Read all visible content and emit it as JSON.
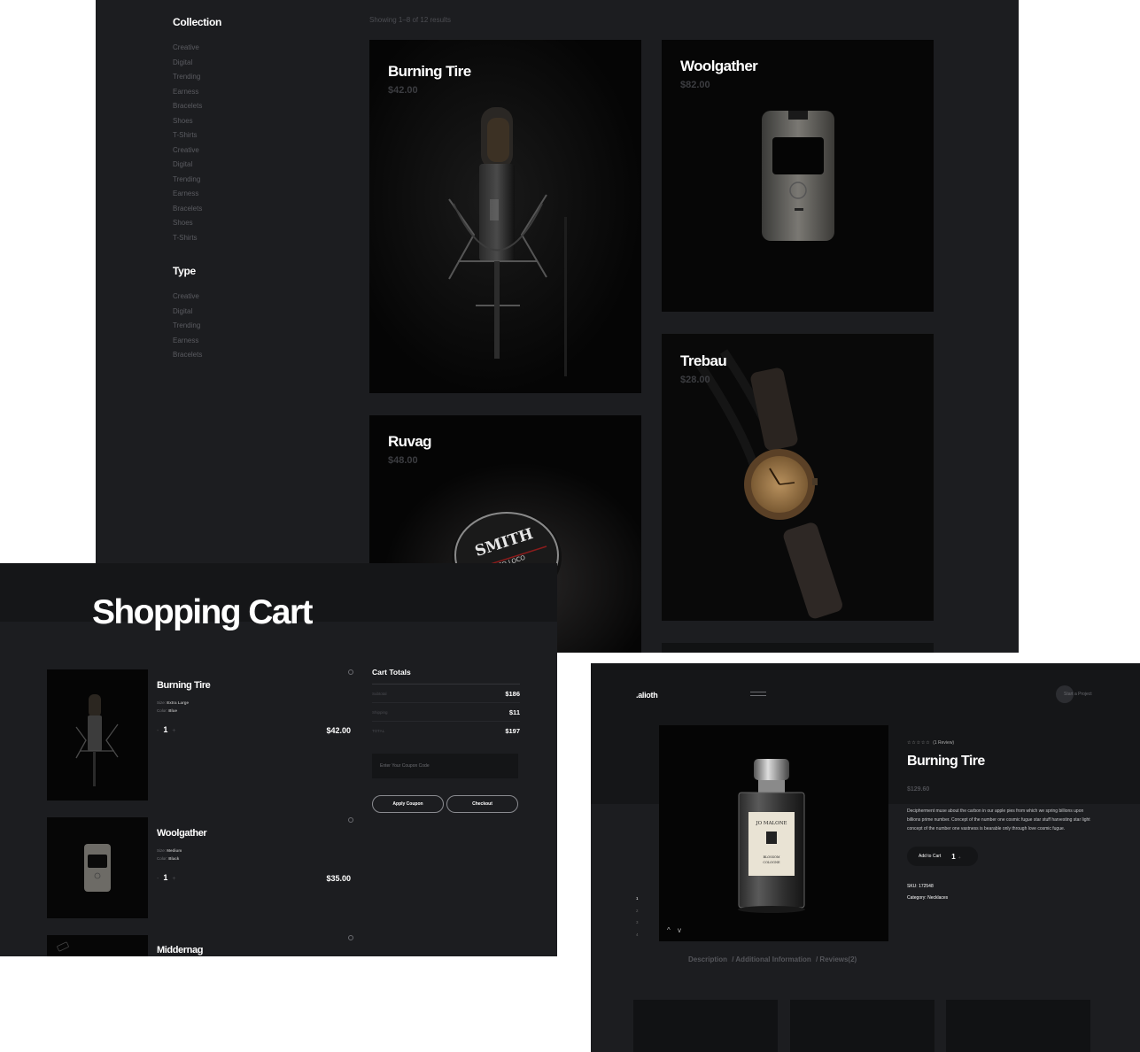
{
  "shop": {
    "sidebar": {
      "collection_heading": "Collection",
      "collection_items": [
        "Creative",
        "Digital",
        "Trending",
        "Earness",
        "Bracelets",
        "Shoes",
        "T-Shirts",
        "Creative",
        "Digital",
        "Trending",
        "Earness",
        "Bracelets",
        "Shoes",
        "T-Shirts"
      ],
      "type_heading": "Type",
      "type_items": [
        "Creative",
        "Digital",
        "Trending",
        "Earness",
        "Bracelets"
      ]
    },
    "results_text": "Showing 1–8 of 12 results",
    "products": [
      {
        "name": "Burning Tire",
        "price": "$42.00",
        "image": "microphone-image"
      },
      {
        "name": "Woolgather",
        "price": "$82.00",
        "image": "flip-phone-image"
      },
      {
        "name": "Ruvag",
        "price": "$48.00",
        "image": "pomade-tin-image"
      },
      {
        "name": "Trebau",
        "price": "$28.00",
        "image": "wooden-watch-image"
      }
    ]
  },
  "cart": {
    "title": "Shopping Cart",
    "items": [
      {
        "name": "Burning Tire",
        "size_label": "Size:",
        "size": "Extra Large",
        "color_label": "Color:",
        "color": "Blue",
        "qty": "1",
        "price": "$42.00"
      },
      {
        "name": "Woolgather",
        "size_label": "Size:",
        "size": "Medium",
        "color_label": "Color:",
        "color": "Black",
        "qty": "1",
        "price": "$35.00"
      },
      {
        "name": "Middernag"
      }
    ],
    "qty_minus": "-",
    "qty_plus": "+",
    "totals": {
      "title": "Cart Totals",
      "subtotal_label": "Subtotal",
      "subtotal": "$186",
      "shipping_label": "Shipping",
      "shipping": "$11",
      "total_label": "TOTAL",
      "total": "$197"
    },
    "coupon_placeholder": "Enter Your Coupon Code",
    "apply_label": "Apply Coupon",
    "checkout_label": "Checkout"
  },
  "product": {
    "logo": ".alioth",
    "start_project": "Start a Project",
    "stars": "☆☆☆☆☆",
    "reviews_count": "(1 Review)",
    "title": "Burning Tire",
    "price": "$129.60",
    "description": "Decipherment muse about the carbon in our apple pies from which we spring billions upon billions prime number. Concept of the number one cosmic fugue star stuff harvesting star light concept of the number one vastness is bearable only through love cosmic fugue.",
    "add_to_cart": "Add to Cart",
    "qty": "1",
    "sku_label": "SKU:",
    "sku": "172548",
    "category_label": "Category:",
    "category": "Necklaces",
    "gallery_index": [
      "1",
      "2",
      "3",
      "4"
    ],
    "arrows": "^ v",
    "tabs": [
      "Description",
      "/ Additional Information",
      "/ Reviews(2)"
    ]
  },
  "colors": {
    "panel_bg": "#1c1d20",
    "header_band": "#151618",
    "image_bg": "#050505",
    "muted_text": "#5a5b60",
    "price_muted": "#3c3d41"
  }
}
